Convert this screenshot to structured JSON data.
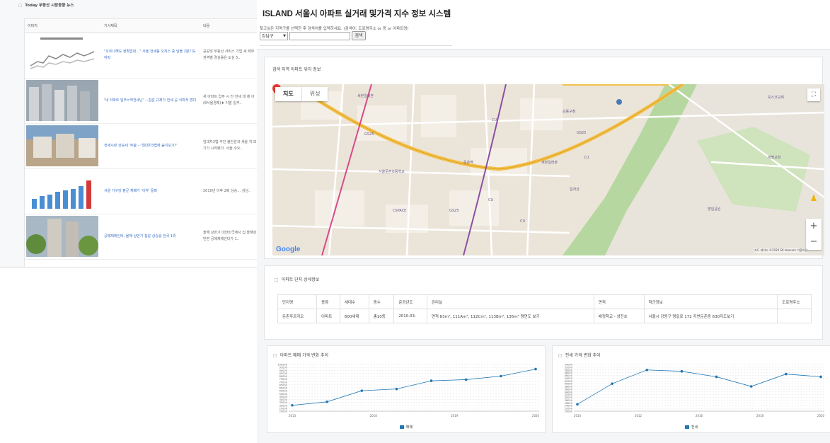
{
  "news": {
    "section_title": "Today 부동산 시장동향 뉴스",
    "headers": [
      "이미지",
      "기사제목",
      "내용"
    ],
    "rows": [
      {
        "title": "\"오르나해도 정확없네…\" 서울 전세등 오피스 중 님들 2분기도 하락",
        "desc": "공공및 부동산 서비스 기업 세 제부 권역별 경실률은 도심 5.."
      },
      {
        "title": "'새 아파트 입주=역전세난' ···집값 규제가 전세 공 식마저 깼다",
        "desc": "새 아파트 입주 시 전 전세 대 제 이(8서울경제)♦ 이말 입주.."
      },
      {
        "title": "전세시장 상승세 '주춤'···'임대차3법에 숨지보기?'",
        "desc": "임대차3법 추진 불안감과 새울 치 보기가 시작됐다. 서울 수요.."
      },
      {
        "title": "서울 가구당 평균 재배가 '이약' 돌파",
        "desc": "2010년 이후 2배 상승… 강남.."
      },
      {
        "title": "공매제에인터, 올해 상반기 집값 상승률 전국 1위",
        "desc": "올해 상반기 대한민국에서 집 올해상반변 공매제에인터가 1.."
      }
    ]
  },
  "app": {
    "title": "ISLAND 서울시 아파트 실거래 및가격 지수 정보 시스템",
    "help": "찾고싶은 지역구를 선택한 후 검색어를 입력하세요. (검색어: 도로명주소 or 동 or 아파트명)",
    "district": "강남구",
    "search_value": "",
    "search_button": "검색"
  },
  "map": {
    "section_title": "검색 지역 아파트 위치 정보",
    "type_map": "지도",
    "type_sat": "위성",
    "fullscreen": "⛶",
    "zoom_in": "+",
    "zoom_out": "−",
    "logo": "Google",
    "copyright": "지도 데이터 ©2020 SK telecom   이용약관",
    "labels": [
      {
        "t": "GS25"
      },
      {
        "t": "세븐일레븐"
      },
      {
        "t": "CU"
      },
      {
        "t": "CU"
      },
      {
        "t": "GS25"
      },
      {
        "t": "CSPACE"
      },
      {
        "t": "서울둔촌초등학교"
      },
      {
        "t": "둔촌역"
      },
      {
        "t": "세븐일레븐"
      },
      {
        "t": "강동구청"
      },
      {
        "t": "GS25"
      },
      {
        "t": "CU"
      },
      {
        "t": "포스코교회"
      },
      {
        "t": "세명교회"
      },
      {
        "t": "명일공원"
      },
      {
        "t": "일자산"
      },
      {
        "t": "CU"
      }
    ]
  },
  "detail": {
    "section_title": "아파트 단지 상세정보",
    "headers": [
      "단지명",
      "종류",
      "세대수",
      "동수",
      "준공년도",
      "관리실",
      "면적",
      "학군정보",
      "도로명주소"
    ],
    "row": [
      "둔촌푸르지오",
      "아파트",
      "600세대",
      "총10동",
      "2010.03.",
      "면적 83m², 111Am², 112Cm², 113Bm², 136m² 평면도 보기",
      "배정학교 - 성진초",
      "서울시 강동구 명일로 172 지번둔촌동 630지도보기",
      ""
    ]
  },
  "charts": {
    "sale_title": "아파트 매매 가격 변화 추이",
    "jeonse_title": "전세 가격 변화 추이",
    "sale_legend": "매매",
    "jeonse_legend": "전세",
    "series_color": "#1f77b4"
  },
  "chart_data": [
    {
      "type": "scatter",
      "title": "아파트 매매 가격 변화 추이",
      "series": [
        {
          "name": "매매",
          "x": [
            "2013",
            "2013.5",
            "2014",
            "2018",
            "2018.5",
            "2019.8",
            "2020.3",
            "2020.5"
          ],
          "values": [
            30000,
            36000,
            55000,
            58000,
            72000,
            74000,
            80000,
            92000
          ]
        }
      ],
      "ylim": [
        20000,
        100000
      ],
      "yticks": [
        20000,
        25000,
        30000,
        35000,
        40000,
        45000,
        50000,
        55000,
        60000,
        65000,
        70000,
        75000,
        80000,
        85000,
        90000,
        95000,
        100000
      ],
      "xticks": [
        "2013",
        "2018",
        "2019",
        "2020"
      ]
    },
    {
      "type": "scatter",
      "title": "전세 가격 변화 추이",
      "series": [
        {
          "name": "전세",
          "x": [
            "2010.1",
            "2010.2",
            "2012",
            "2015",
            "2016",
            "2018",
            "2019",
            "2020"
          ],
          "values": [
            25000,
            40000,
            50000,
            49000,
            45000,
            38000,
            47000,
            45000
          ]
        }
      ],
      "ylim": [
        20000,
        54000
      ],
      "yticks": [
        20000,
        22000,
        24000,
        26000,
        28000,
        30000,
        32000,
        34000,
        36000,
        38000,
        40000,
        42000,
        44000,
        46000,
        48000,
        50000,
        52000,
        54000
      ],
      "xticks": [
        "2010",
        "2012",
        "2016",
        "2018",
        "2020"
      ]
    }
  ]
}
